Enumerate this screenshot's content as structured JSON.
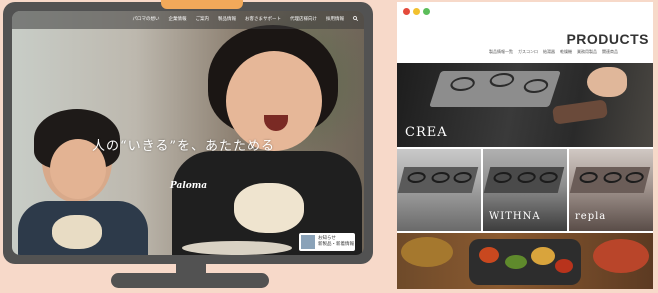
{
  "desktop_site": {
    "nav_items": [
      "パロマの想い",
      "企業情報",
      "ご案内",
      "製品情報",
      "お客さまサポート",
      "代理店様向け",
      "採用情報"
    ],
    "tagline": "人の“いきる”を、あたためる",
    "brand": "Paloma",
    "news_banner": {
      "line1": "お知らせ",
      "line2": "新製品・新着情報"
    }
  },
  "mobile_site": {
    "heading": "PRODUCTS",
    "filters": [
      "製品情報一覧",
      "ガスコンロ",
      "給湯器",
      "乾燥機",
      "業務用製品",
      "関連商品"
    ],
    "products": [
      "CREA",
      "WITHNA",
      "repla"
    ]
  },
  "colors": {
    "background": "#f7d9c9",
    "monitor_frame": "#525252",
    "notch_accent": "#f2a95a",
    "dot_red": "#e44a3b",
    "dot_yellow": "#f2c12e",
    "dot_green": "#5bbd5a"
  }
}
